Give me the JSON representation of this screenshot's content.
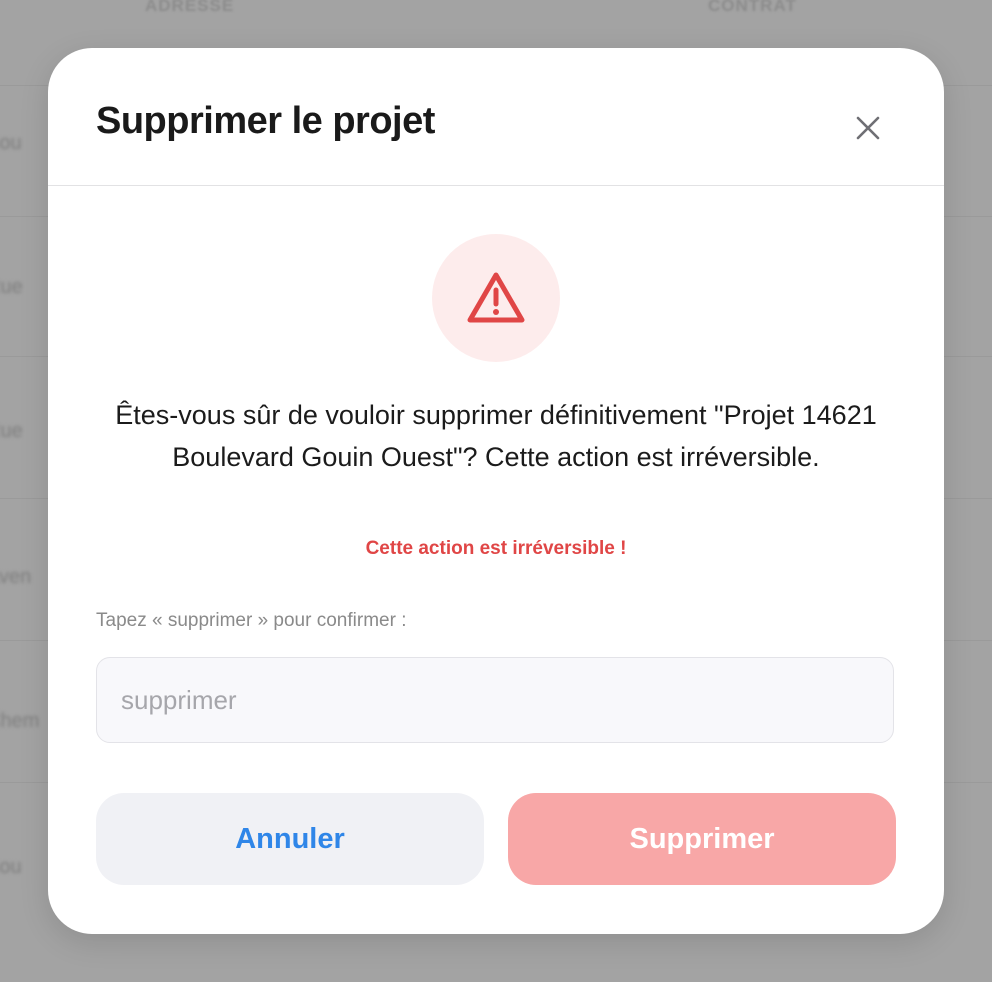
{
  "background": {
    "headers": [
      "ADRESSE",
      "CONTRAT"
    ],
    "rows": [
      "Bou",
      "Rue",
      "Rue",
      "Aven",
      "Chem",
      "Bou"
    ]
  },
  "modal": {
    "title": "Supprimer le projet",
    "close_icon": "close-icon",
    "warning_icon": "warning-triangle-icon",
    "message": "Êtes-vous sûr de vouloir supprimer définitivement \"Projet 14621 Boulevard Gouin Ouest\"? Cette action est irréversible.",
    "irreversible_note": "Cette action est irréversible !",
    "confirm_label": "Tapez « supprimer » pour confirmer :",
    "confirm_input": {
      "value": "",
      "placeholder": "supprimer"
    },
    "cancel_label": "Annuler",
    "delete_label": "Supprimer"
  },
  "colors": {
    "danger": "#e04646",
    "danger_light": "#fdecec",
    "delete_disabled": "#f8a7a7",
    "link_blue": "#2f86e8"
  }
}
